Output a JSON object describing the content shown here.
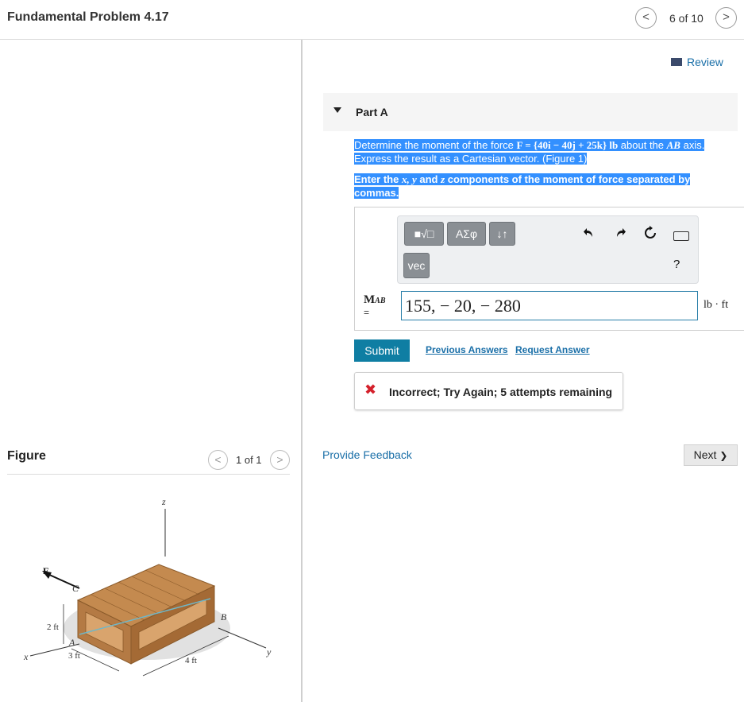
{
  "header": {
    "title": "Fundamental Problem 4.17",
    "pager_text": "6 of 10",
    "prev_glyph": "<",
    "next_glyph": ">"
  },
  "review": {
    "label": "Review"
  },
  "part": {
    "label": "Part A",
    "question_prefix": "Determine the moment of the force ",
    "question_force": "F = {40i − 40j + 25k} lb",
    "question_about": " about the ",
    "question_axis": "AB",
    "question_rest": " axis. Express the result as a Cartesian vector. (Figure 1)",
    "instruction_prefix": "Enter the ",
    "instruction_vars": "x, y",
    "instruction_and": " and ",
    "instruction_z": "z",
    "instruction_rest": " components of the moment of force separated by commas."
  },
  "toolbar": {
    "template_button": "■√□",
    "greek_button": "ΑΣφ",
    "arrows_button": "↓↑",
    "vec_button": "vec",
    "help_label": "?"
  },
  "answer": {
    "label_main": "M",
    "label_sub": "AB",
    "label_eq": "=",
    "value": "155, − 20, − 280",
    "unit": "lb · ft"
  },
  "actions": {
    "submit": "Submit",
    "previous_answers": "Previous Answers",
    "request_answer": "Request Answer"
  },
  "feedback": {
    "icon": "✖",
    "message": "Incorrect; Try Again; 5 attempts remaining"
  },
  "footer": {
    "provide_feedback": "Provide Feedback",
    "next": "Next",
    "next_glyph": "❯"
  },
  "figure": {
    "title": "Figure",
    "page": "1 of 1",
    "labels": {
      "z": "z",
      "y": "y",
      "x": "x",
      "F": "F",
      "A": "A",
      "B": "B",
      "C": "C",
      "dim_2ft": "2 ft",
      "dim_3ft": "3 ft",
      "dim_4ft": "4 ft"
    },
    "colors": {
      "crate": "#c48a4f",
      "crate_dark": "#a46a35",
      "crate_side": "#b47a44",
      "cable": "#6fb7c9",
      "shadow": "#d9d9d9"
    }
  }
}
